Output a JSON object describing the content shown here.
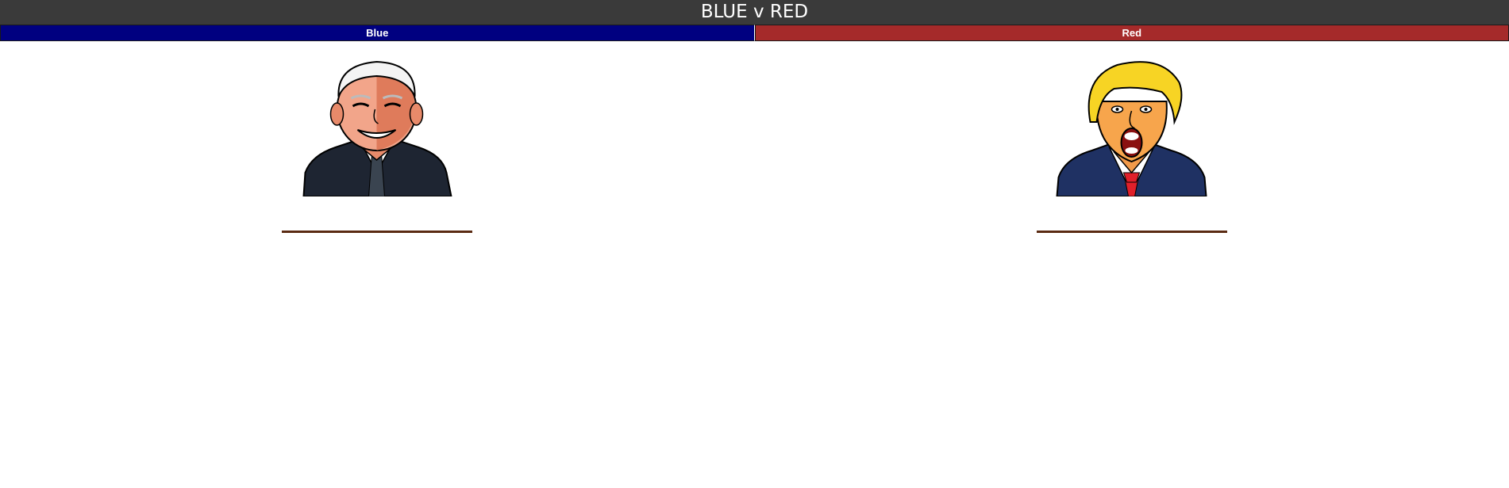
{
  "header": {
    "title": "BLUE v RED"
  },
  "tabs": [
    {
      "label": "Blue",
      "color": "#000080"
    },
    {
      "label": "Red",
      "color": "#a52a2a"
    }
  ],
  "panels": {
    "left": {
      "portrait_icon": "cartoon-portrait-white-hair"
    },
    "right": {
      "portrait_icon": "cartoon-portrait-yellow-hair"
    }
  },
  "colors": {
    "title_bar": "#3a3a3a",
    "divider": "#5a2a12"
  }
}
